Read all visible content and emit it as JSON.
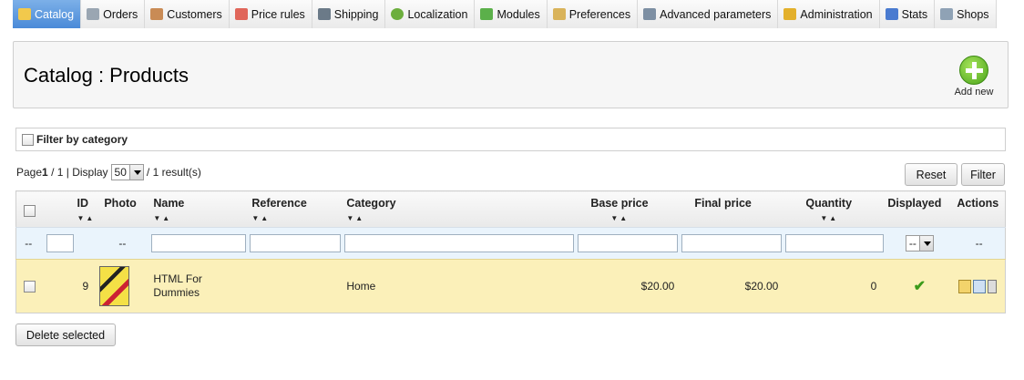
{
  "tabs": [
    {
      "label": "Catalog",
      "icon": "folder-icon",
      "active": true
    },
    {
      "label": "Orders",
      "icon": "cart-icon"
    },
    {
      "label": "Customers",
      "icon": "person-icon"
    },
    {
      "label": "Price rules",
      "icon": "price-tag-icon"
    },
    {
      "label": "Shipping",
      "icon": "truck-icon"
    },
    {
      "label": "Localization",
      "icon": "globe-icon"
    },
    {
      "label": "Modules",
      "icon": "puzzle-icon"
    },
    {
      "label": "Preferences",
      "icon": "form-icon"
    },
    {
      "label": "Advanced parameters",
      "icon": "wrench-icon"
    },
    {
      "label": "Administration",
      "icon": "key-icon"
    },
    {
      "label": "Stats",
      "icon": "bar-chart-icon"
    },
    {
      "label": "Shops",
      "icon": "shop-icon"
    }
  ],
  "header": {
    "title": "Catalog : Products",
    "add_new": "Add new"
  },
  "filter_by_category": "Filter by category",
  "pager": {
    "page_label": "Page",
    "page": "1",
    "total": "/ 1 | Display",
    "display": "50",
    "results": "/ 1 result(s)"
  },
  "buttons": {
    "reset": "Reset",
    "filter": "Filter",
    "delete_selected": "Delete selected"
  },
  "columns": {
    "id": "ID",
    "photo": "Photo",
    "name": "Name",
    "reference": "Reference",
    "category": "Category",
    "base_price": "Base price",
    "final_price": "Final price",
    "quantity": "Quantity",
    "displayed": "Displayed",
    "actions": "Actions"
  },
  "filter_row": {
    "dash": "--",
    "displayed_select": "--"
  },
  "rows": [
    {
      "id": "9",
      "name": "HTML For Dummies",
      "reference": "",
      "category": "Home",
      "base_price": "$20.00",
      "final_price": "$20.00",
      "quantity": "0",
      "displayed": true
    }
  ],
  "colors": {
    "active_tab": "#4a8ad8",
    "row_bg": "#fbf0b9",
    "filter_bg": "#eaf4fc",
    "check": "#3a9a1a"
  }
}
